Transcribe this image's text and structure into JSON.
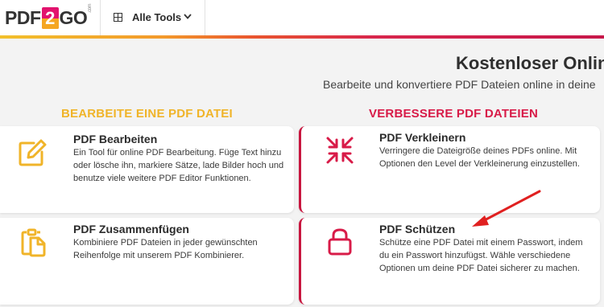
{
  "header": {
    "logo": {
      "prefix": "PDF",
      "digit": "2",
      "suffix": "GO",
      "small": ".com"
    },
    "tools_button": {
      "label": "Alle Tools",
      "icon": "grid-icon",
      "chevron": "chevron-down-icon"
    }
  },
  "hero": {
    "title": "Kostenloser Onlin",
    "subtitle": "Bearbeite und konvertiere PDF Dateien online in deine"
  },
  "sections": {
    "left_heading": "BEARBEITE EINE PDF DATEI",
    "right_heading": "VERBESSERE PDF DATEIEN"
  },
  "cards": [
    {
      "title": "PDF Bearbeiten",
      "desc": "Ein Tool für online PDF Bearbeitung. Füge Text hinzu oder lösche ihn, markiere Sätze, lade Bilder hoch und benutze viele weitere PDF Editor Funktionen.",
      "icon": "edit-icon"
    },
    {
      "title": "PDF Verkleinern",
      "desc": "Verringere die Dateigröße deines PDFs online. Mit Optionen den Level der Verkleinerung einzustellen.",
      "icon": "compress-icon"
    },
    {
      "title": "PDF Zusammenfügen",
      "desc": "Kombiniere PDF Dateien in jeder gewünschten Reihenfolge mit unserem PDF Kombinierer.",
      "icon": "merge-icon"
    },
    {
      "title": "PDF Schützen",
      "desc": "Schütze eine PDF Datei mit einem Passwort, indem du ein Passwort hinzufügst. Wähle verschiedene Optionen um deine PDF Datei sicherer zu machen.",
      "icon": "lock-icon"
    }
  ],
  "colors": {
    "yellow": "#f0b429",
    "red": "#d81b48",
    "annotation_arrow": "#e02020"
  }
}
